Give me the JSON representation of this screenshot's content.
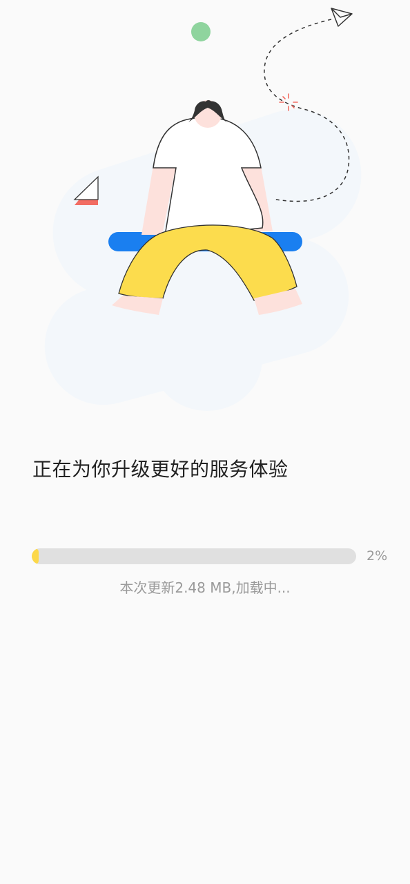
{
  "upgrade": {
    "headline": "正在为你升级更好的服务体验",
    "progress_percent_label": "2%",
    "progress_value": 0.02,
    "status_text": "本次更新2.48 MB,加载中..."
  },
  "illustration": {
    "accent_yellow": "#fcd84a",
    "accent_blue": "#1a7ff0",
    "accent_green": "#8fd49e",
    "accent_red": "#f26d63"
  },
  "colors": {
    "background": "#fafafa",
    "headline": "#222222",
    "secondary_text": "#9a9a9a",
    "progress_track": "#e0e0e0",
    "progress_fill": "#fcd84a"
  }
}
